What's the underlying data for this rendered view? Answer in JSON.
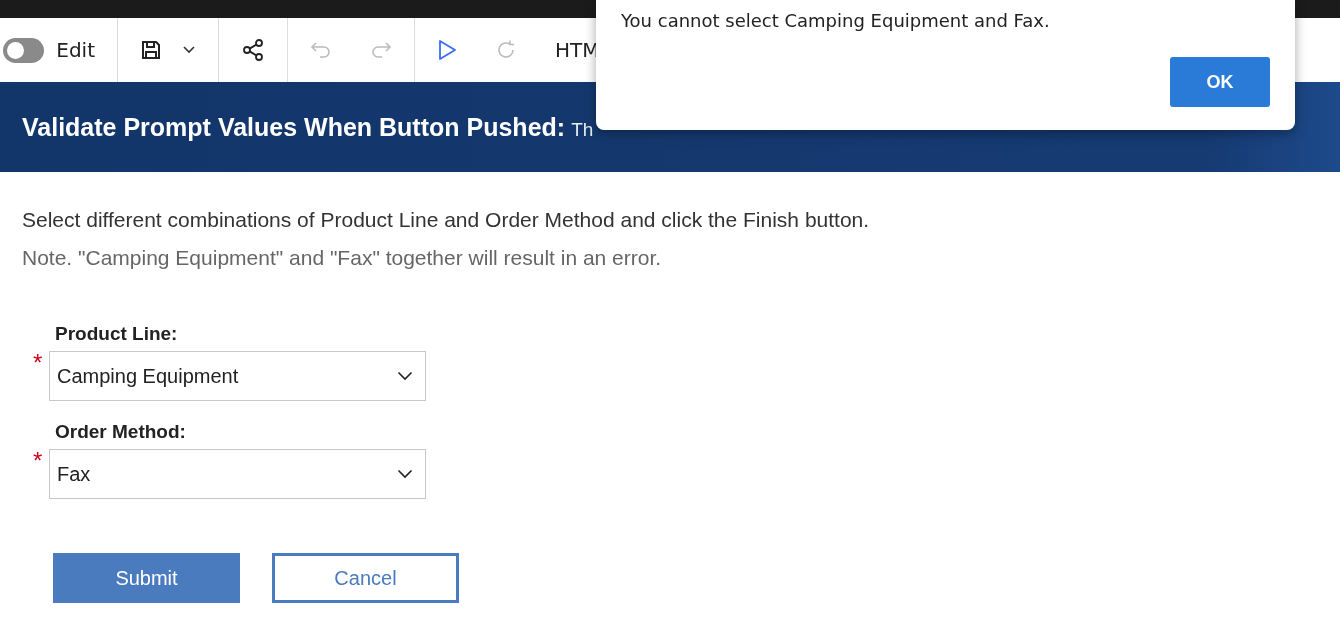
{
  "toolbar": {
    "edit_toggle": {
      "label": "Edit",
      "on": false
    },
    "format_label": "HTM"
  },
  "banner": {
    "title": "Validate Prompt Values When Button Pushed:",
    "description": "Th"
  },
  "instructions": [
    "Select different combinations of Product Line and Order Method and click the Finish button.",
    "Note. \"Camping Equipment\" and \"Fax\" together will result in an error."
  ],
  "prompts": [
    {
      "label": "Product Line:",
      "required_mark": "*",
      "value": "Camping Equipment"
    },
    {
      "label": "Order Method:",
      "required_mark": "*",
      "value": "Fax"
    }
  ],
  "buttons": [
    {
      "label": "Submit",
      "kind": "primary"
    },
    {
      "label": "Cancel",
      "kind": "secondary"
    }
  ],
  "dialog": {
    "message": "You cannot select Camping Equipment and Fax.",
    "button": "OK"
  }
}
